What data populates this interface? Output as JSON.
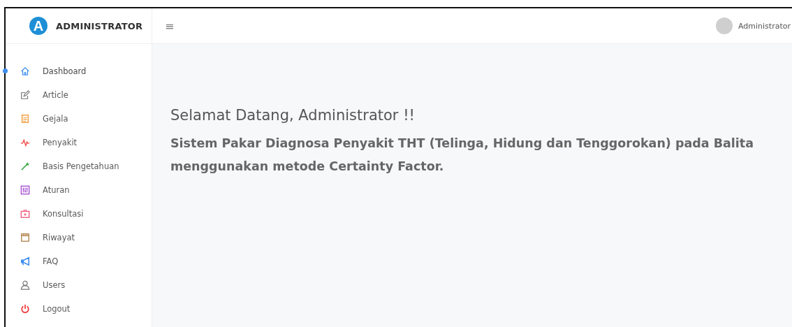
{
  "brand": {
    "logo_letter": "A",
    "name": "ADMINISTRATOR"
  },
  "header": {
    "menu_glyph": "≡",
    "user_name": "Administrator"
  },
  "sidebar": {
    "items": [
      {
        "label": "Dashboard",
        "kind": "home",
        "color": "#3d8ef0",
        "selected": true
      },
      {
        "label": "Article",
        "kind": "edit",
        "color": "#777777",
        "selected": false
      },
      {
        "label": "Gejala",
        "kind": "note",
        "color": "#f39c3c",
        "selected": false
      },
      {
        "label": "Penyakit",
        "kind": "pulse",
        "color": "#f0443c",
        "selected": false
      },
      {
        "label": "Basis Pengetahuan",
        "kind": "wand",
        "color": "#3aa845",
        "selected": false
      },
      {
        "label": "Aturan",
        "kind": "sliders",
        "color": "#a44bd0",
        "selected": false
      },
      {
        "label": "Konsultasi",
        "kind": "medkit",
        "color": "#f05a7a",
        "selected": false
      },
      {
        "label": "Riwayat",
        "kind": "calendar",
        "color": "#b0824a",
        "selected": false
      },
      {
        "label": "FAQ",
        "kind": "megaphone",
        "color": "#3d8ef0",
        "selected": false
      },
      {
        "label": "Users",
        "kind": "user",
        "color": "#777777",
        "selected": false
      },
      {
        "label": "Logout",
        "kind": "power",
        "color": "#f03c3c",
        "selected": false
      }
    ]
  },
  "main": {
    "heading": "Selamat Datang, Administrator !!",
    "subtitle": "Sistem Pakar Diagnosa Penyakit THT (Telinga, Hidung dan Tenggorokan) pada Balita menggunakan metode Certainty Factor."
  }
}
